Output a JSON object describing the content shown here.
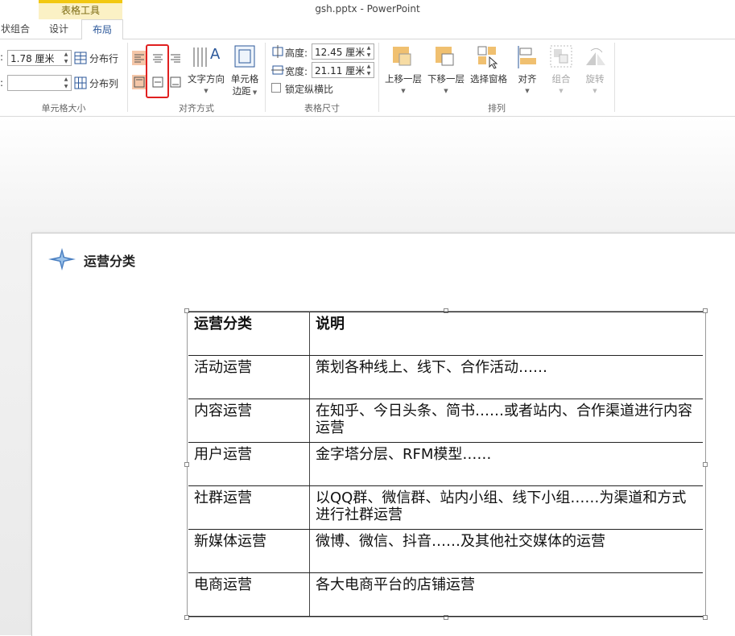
{
  "window": {
    "title": "gsh.pptx - PowerPoint"
  },
  "context_tab_group": "表格工具",
  "tabs": [
    {
      "label": "状组合"
    },
    {
      "label": "设计"
    },
    {
      "label": "布局"
    }
  ],
  "ribbon": {
    "cell_size": {
      "height_value": "1.78 厘米",
      "width_value": "",
      "distribute_rows": "分布行",
      "distribute_cols": "分布列",
      "group_label": "单元格大小"
    },
    "alignment": {
      "text_direction": "文字方向",
      "cell_margins_1": "单元格",
      "cell_margins_2": "边距",
      "group_label": "对齐方式"
    },
    "table_size": {
      "height_label": "高度:",
      "height_value": "12.45 厘米",
      "width_label": "宽度:",
      "width_value": "21.11 厘米",
      "lock_ratio": "锁定纵横比",
      "group_label": "表格尺寸"
    },
    "arrange": {
      "bring_forward": "上移一层",
      "send_backward": "下移一层",
      "selection_pane": "选择窗格",
      "align": "对齐",
      "group": "组合",
      "rotate": "旋转",
      "group_label": "排列"
    }
  },
  "slide": {
    "title": "运营分类",
    "table": {
      "rows": [
        {
          "c1": "运营分类",
          "c2": "说明"
        },
        {
          "c1": "活动运营",
          "c2": "策划各种线上、线下、合作活动……"
        },
        {
          "c1": "内容运营",
          "c2": "在知乎、今日头条、简书……或者站内、合作渠道进行内容运营"
        },
        {
          "c1": "用户运营",
          "c2": "金字塔分层、RFM模型……"
        },
        {
          "c1": "社群运营",
          "c2": "以QQ群、微信群、站内小组、线下小组……为渠道和方式进行社群运营"
        },
        {
          "c1": "新媒体运营",
          "c2": "微博、微信、抖音……及其他社交媒体的运营"
        },
        {
          "c1": "电商运营",
          "c2": "各大电商平台的店铺运营"
        }
      ]
    }
  },
  "colors": {
    "accent": "#2b579a",
    "context_band": "#f2c811",
    "highlight_box": "#e02020",
    "icon_orange": "#f0c070"
  }
}
